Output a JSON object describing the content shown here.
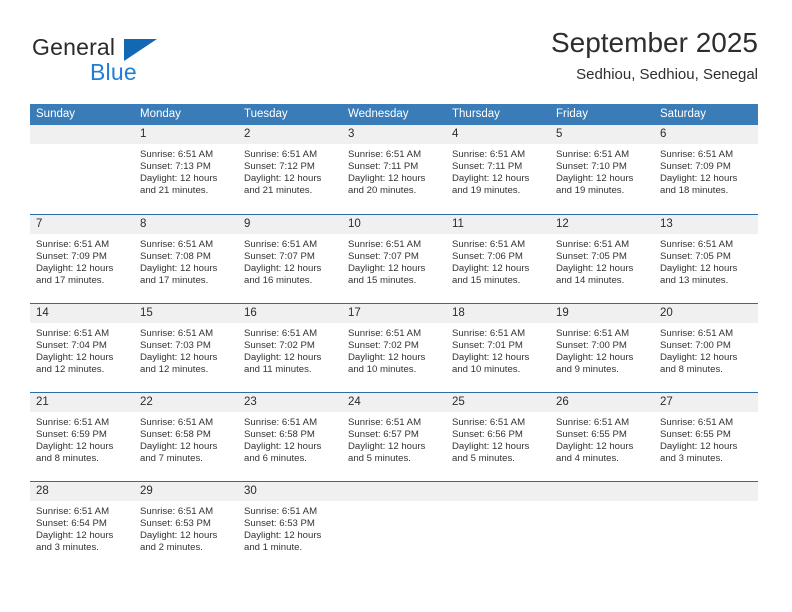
{
  "brand": {
    "name_part1": "General",
    "name_part2": "Blue",
    "accent_color": "#1f7fd4",
    "triangle_color": "#1268b3"
  },
  "header": {
    "month_title": "September 2025",
    "location": "Sedhiou, Sedhiou, Senegal"
  },
  "calendar": {
    "header_bg_color": "#3a7cb8",
    "daynum_band_color": "#f0f0f0",
    "weekdays": [
      "Sunday",
      "Monday",
      "Tuesday",
      "Wednesday",
      "Thursday",
      "Friday",
      "Saturday"
    ],
    "weeks": [
      [
        {
          "day": "",
          "lines": []
        },
        {
          "day": "1",
          "lines": [
            "Sunrise: 6:51 AM",
            "Sunset: 7:13 PM",
            "Daylight: 12 hours",
            "and 21 minutes."
          ]
        },
        {
          "day": "2",
          "lines": [
            "Sunrise: 6:51 AM",
            "Sunset: 7:12 PM",
            "Daylight: 12 hours",
            "and 21 minutes."
          ]
        },
        {
          "day": "3",
          "lines": [
            "Sunrise: 6:51 AM",
            "Sunset: 7:11 PM",
            "Daylight: 12 hours",
            "and 20 minutes."
          ]
        },
        {
          "day": "4",
          "lines": [
            "Sunrise: 6:51 AM",
            "Sunset: 7:11 PM",
            "Daylight: 12 hours",
            "and 19 minutes."
          ]
        },
        {
          "day": "5",
          "lines": [
            "Sunrise: 6:51 AM",
            "Sunset: 7:10 PM",
            "Daylight: 12 hours",
            "and 19 minutes."
          ]
        },
        {
          "day": "6",
          "lines": [
            "Sunrise: 6:51 AM",
            "Sunset: 7:09 PM",
            "Daylight: 12 hours",
            "and 18 minutes."
          ]
        }
      ],
      [
        {
          "day": "7",
          "lines": [
            "Sunrise: 6:51 AM",
            "Sunset: 7:09 PM",
            "Daylight: 12 hours",
            "and 17 minutes."
          ]
        },
        {
          "day": "8",
          "lines": [
            "Sunrise: 6:51 AM",
            "Sunset: 7:08 PM",
            "Daylight: 12 hours",
            "and 17 minutes."
          ]
        },
        {
          "day": "9",
          "lines": [
            "Sunrise: 6:51 AM",
            "Sunset: 7:07 PM",
            "Daylight: 12 hours",
            "and 16 minutes."
          ]
        },
        {
          "day": "10",
          "lines": [
            "Sunrise: 6:51 AM",
            "Sunset: 7:07 PM",
            "Daylight: 12 hours",
            "and 15 minutes."
          ]
        },
        {
          "day": "11",
          "lines": [
            "Sunrise: 6:51 AM",
            "Sunset: 7:06 PM",
            "Daylight: 12 hours",
            "and 15 minutes."
          ]
        },
        {
          "day": "12",
          "lines": [
            "Sunrise: 6:51 AM",
            "Sunset: 7:05 PM",
            "Daylight: 12 hours",
            "and 14 minutes."
          ]
        },
        {
          "day": "13",
          "lines": [
            "Sunrise: 6:51 AM",
            "Sunset: 7:05 PM",
            "Daylight: 12 hours",
            "and 13 minutes."
          ]
        }
      ],
      [
        {
          "day": "14",
          "lines": [
            "Sunrise: 6:51 AM",
            "Sunset: 7:04 PM",
            "Daylight: 12 hours",
            "and 12 minutes."
          ]
        },
        {
          "day": "15",
          "lines": [
            "Sunrise: 6:51 AM",
            "Sunset: 7:03 PM",
            "Daylight: 12 hours",
            "and 12 minutes."
          ]
        },
        {
          "day": "16",
          "lines": [
            "Sunrise: 6:51 AM",
            "Sunset: 7:02 PM",
            "Daylight: 12 hours",
            "and 11 minutes."
          ]
        },
        {
          "day": "17",
          "lines": [
            "Sunrise: 6:51 AM",
            "Sunset: 7:02 PM",
            "Daylight: 12 hours",
            "and 10 minutes."
          ]
        },
        {
          "day": "18",
          "lines": [
            "Sunrise: 6:51 AM",
            "Sunset: 7:01 PM",
            "Daylight: 12 hours",
            "and 10 minutes."
          ]
        },
        {
          "day": "19",
          "lines": [
            "Sunrise: 6:51 AM",
            "Sunset: 7:00 PM",
            "Daylight: 12 hours",
            "and 9 minutes."
          ]
        },
        {
          "day": "20",
          "lines": [
            "Sunrise: 6:51 AM",
            "Sunset: 7:00 PM",
            "Daylight: 12 hours",
            "and 8 minutes."
          ]
        }
      ],
      [
        {
          "day": "21",
          "lines": [
            "Sunrise: 6:51 AM",
            "Sunset: 6:59 PM",
            "Daylight: 12 hours",
            "and 8 minutes."
          ]
        },
        {
          "day": "22",
          "lines": [
            "Sunrise: 6:51 AM",
            "Sunset: 6:58 PM",
            "Daylight: 12 hours",
            "and 7 minutes."
          ]
        },
        {
          "day": "23",
          "lines": [
            "Sunrise: 6:51 AM",
            "Sunset: 6:58 PM",
            "Daylight: 12 hours",
            "and 6 minutes."
          ]
        },
        {
          "day": "24",
          "lines": [
            "Sunrise: 6:51 AM",
            "Sunset: 6:57 PM",
            "Daylight: 12 hours",
            "and 5 minutes."
          ]
        },
        {
          "day": "25",
          "lines": [
            "Sunrise: 6:51 AM",
            "Sunset: 6:56 PM",
            "Daylight: 12 hours",
            "and 5 minutes."
          ]
        },
        {
          "day": "26",
          "lines": [
            "Sunrise: 6:51 AM",
            "Sunset: 6:55 PM",
            "Daylight: 12 hours",
            "and 4 minutes."
          ]
        },
        {
          "day": "27",
          "lines": [
            "Sunrise: 6:51 AM",
            "Sunset: 6:55 PM",
            "Daylight: 12 hours",
            "and 3 minutes."
          ]
        }
      ],
      [
        {
          "day": "28",
          "lines": [
            "Sunrise: 6:51 AM",
            "Sunset: 6:54 PM",
            "Daylight: 12 hours",
            "and 3 minutes."
          ]
        },
        {
          "day": "29",
          "lines": [
            "Sunrise: 6:51 AM",
            "Sunset: 6:53 PM",
            "Daylight: 12 hours",
            "and 2 minutes."
          ]
        },
        {
          "day": "30",
          "lines": [
            "Sunrise: 6:51 AM",
            "Sunset: 6:53 PM",
            "Daylight: 12 hours",
            "and 1 minute."
          ]
        },
        {
          "day": "",
          "lines": []
        },
        {
          "day": "",
          "lines": []
        },
        {
          "day": "",
          "lines": []
        },
        {
          "day": "",
          "lines": []
        }
      ]
    ]
  }
}
